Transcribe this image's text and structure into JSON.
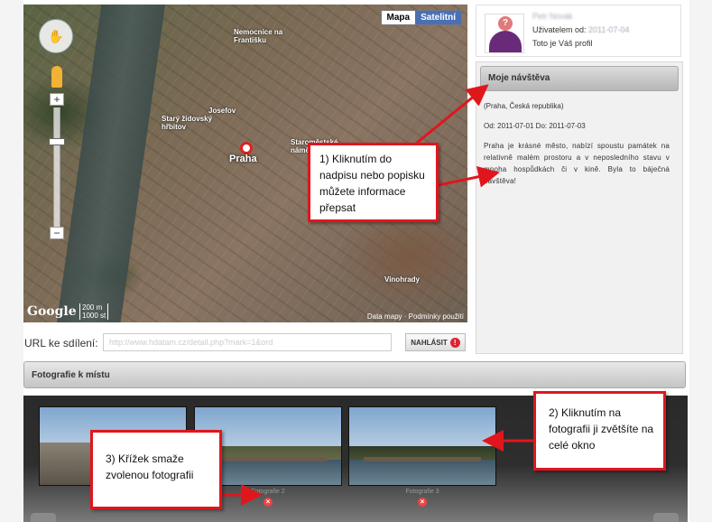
{
  "map": {
    "type_buttons": [
      "Mapa",
      "Satelitní"
    ],
    "place_labels": [
      "Nemocnice na Františku",
      "Starý židovský hřbitov",
      "Josefov",
      "Staroměstské náměstí",
      "Praha",
      "Vinohrady"
    ],
    "city": "Praha",
    "google": "Google",
    "scale": [
      "200 m",
      "1000 st"
    ],
    "footer": "Data mapy · Podmínky použití"
  },
  "url_row": {
    "label": "URL ke sdílení:",
    "value": "http://www.hdatam.cz/detail.php?mark=1&ord",
    "report_label": "Nahlásit"
  },
  "profile": {
    "name": "Petr Novák",
    "member_since_label": "Uživatelem od:",
    "member_since_date": "2011-07-04",
    "own_profile_note": "Toto je Váš profil"
  },
  "visits": {
    "header": "Moje návštěva",
    "place": "(Praha, Česká republika)",
    "dates": "Od: 2011-07-01 Do: 2011-07-03",
    "text": "Praha je krásné město, nabízí spoustu památek na relativně malém prostoru a v neposledního stavu v mnoha hospůdkách či v kině. Byla to báječná návštěva!"
  },
  "photos": {
    "header": "Fotografie k místu",
    "items": [
      {
        "caption": ""
      },
      {
        "caption": "Fotografie 2"
      },
      {
        "caption": "Fotografie 3"
      }
    ],
    "delete_icon": "x-icon"
  },
  "callouts": {
    "one": "1) Kliknutím do nadpisu nebo popisku můžete informace přepsat",
    "two": "2) Kliknutím na fotografii ji zvětšíte na celé okno",
    "three": "3) Křížek smaže zvolenou fotografii"
  },
  "colors": {
    "callout_border": "#e0161d",
    "satellite_button": "#4a6fb5"
  }
}
